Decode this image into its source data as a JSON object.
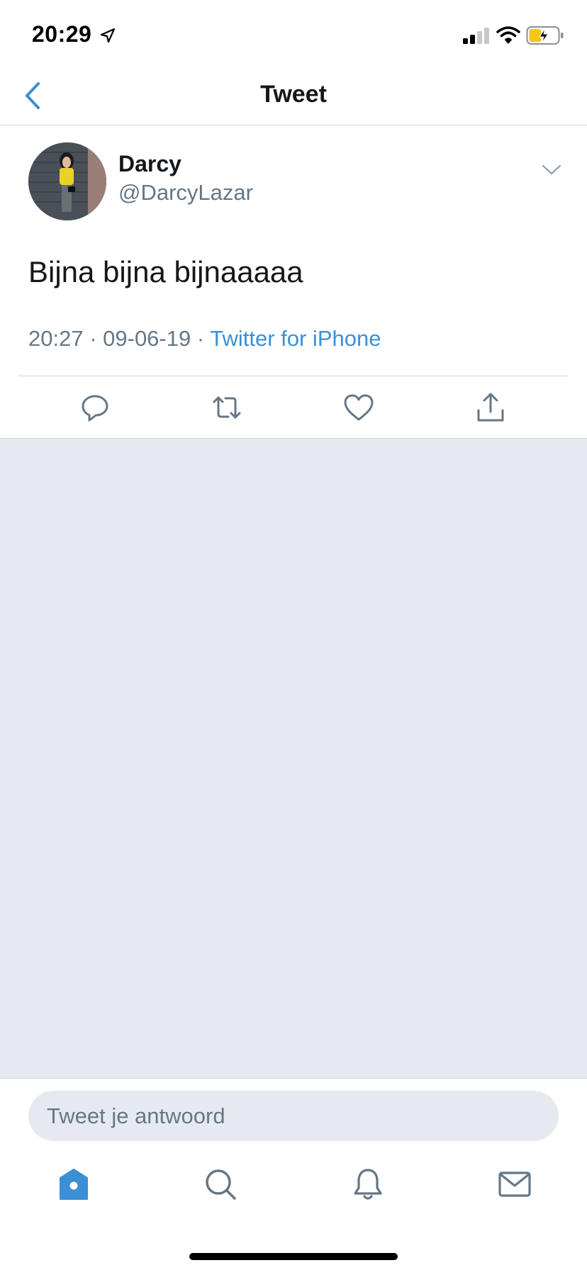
{
  "status_bar": {
    "time": "20:29"
  },
  "nav": {
    "title": "Tweet"
  },
  "tweet": {
    "author_name": "Darcy",
    "author_handle": "@DarcyLazar",
    "text": "Bijna bijna bijnaaaaa",
    "time": "20:27",
    "separator": " · ",
    "date": "09-06-19",
    "source": "Twitter for iPhone"
  },
  "actions": [
    "reply-icon",
    "retweet-icon",
    "like-icon",
    "share-icon"
  ],
  "reply": {
    "placeholder": "Tweet je antwoord"
  },
  "tabs": [
    "home-icon",
    "search-icon",
    "notifications-icon",
    "messages-icon"
  ],
  "colors": {
    "accent": "#3b8fd6",
    "secondary_text": "#657786",
    "background_gray": "#e6eaf0",
    "battery": "#f5c518"
  }
}
